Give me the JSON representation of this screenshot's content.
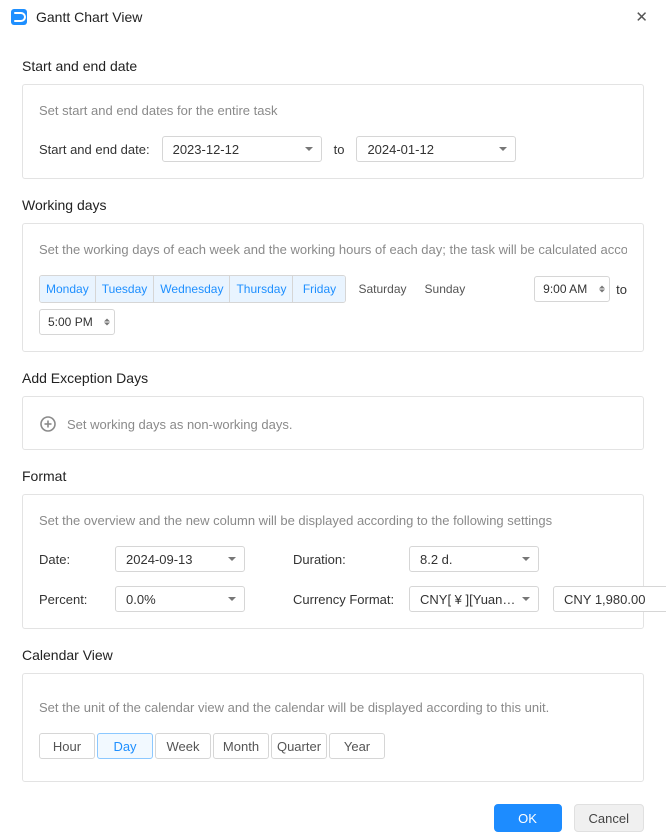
{
  "window": {
    "title": "Gantt Chart View"
  },
  "sections": {
    "dates": {
      "heading": "Start and end date",
      "desc": "Set start and end dates for the entire task",
      "label": "Start and end date:",
      "start": "2023-12-12",
      "to": "to",
      "end": "2024-01-12"
    },
    "working": {
      "heading": "Working days",
      "desc": "Set the working days of each week and the working hours of each day; the task will be calculated according to th",
      "days": {
        "mon": "Monday",
        "tue": "Tuesday",
        "wed": "Wednesday",
        "thu": "Thursday",
        "fri": "Friday",
        "sat": "Saturday",
        "sun": "Sunday"
      },
      "start_time": "9:00 AM",
      "to": "to",
      "end_time": "5:00 PM"
    },
    "exception": {
      "heading": "Add Exception Days",
      "desc": "Set working days as non-working days."
    },
    "format": {
      "heading": "Format",
      "desc": "Set the overview and the new column will be displayed according to the following settings",
      "date_label": "Date:",
      "date_value": "2024-09-13",
      "duration_label": "Duration:",
      "duration_value": "8.2 d.",
      "percent_label": "Percent:",
      "percent_value": "0.0%",
      "currency_label": "Currency Format:",
      "currency_type": "CNY[ ¥ ][Yuan Ren...",
      "currency_value": "CNY 1,980.00"
    },
    "calendar": {
      "heading": "Calendar View",
      "desc": "Set the unit of the calendar view and the calendar will be displayed according to this unit.",
      "units": {
        "hour": "Hour",
        "day": "Day",
        "week": "Week",
        "month": "Month",
        "quarter": "Quarter",
        "year": "Year"
      }
    }
  },
  "footer": {
    "ok": "OK",
    "cancel": "Cancel"
  }
}
